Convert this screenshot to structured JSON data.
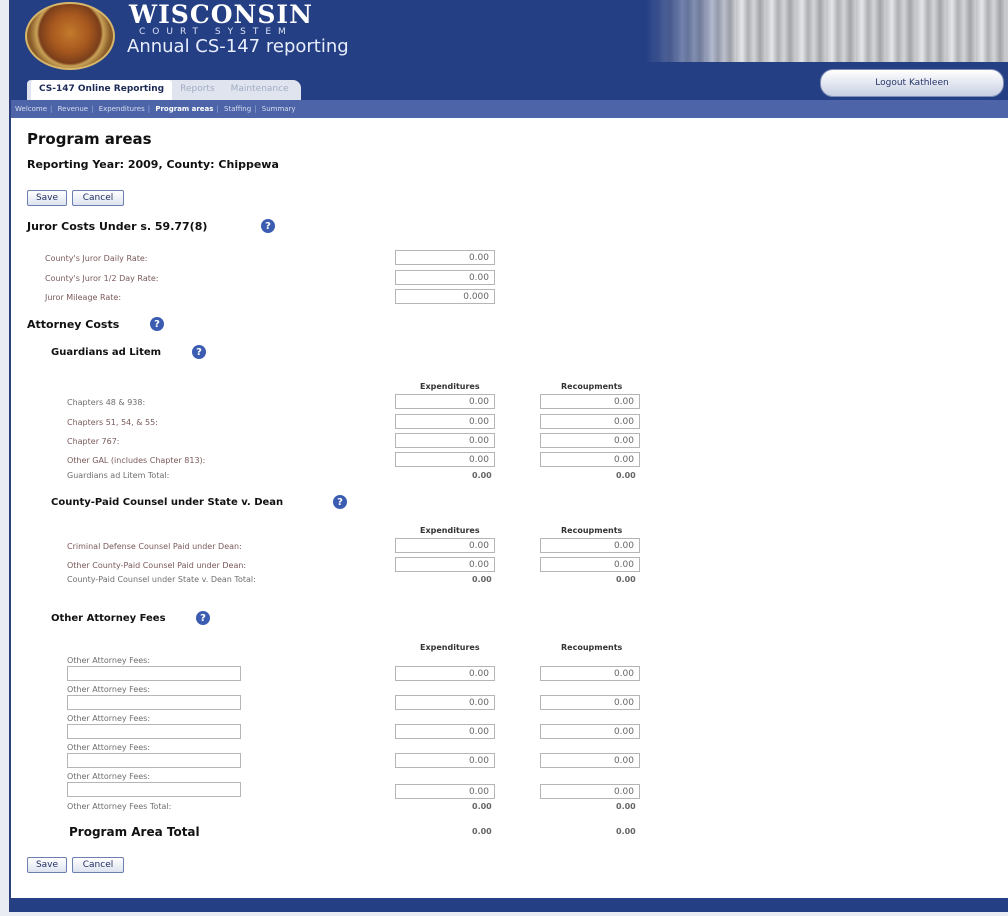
{
  "header": {
    "title_main": "WISCONSIN",
    "title_sub": "COURT SYSTEM",
    "title_app": "Annual CS-147 reporting",
    "logout_label": "Logout Kathleen"
  },
  "tabs": [
    {
      "label": "CS-147 Online Reporting",
      "active": true
    },
    {
      "label": "Reports",
      "active": false
    },
    {
      "label": "Maintenance",
      "active": false
    }
  ],
  "subnav": [
    "Welcome",
    "Revenue",
    "Expenditures",
    "Program areas",
    "Staffing",
    "Summary"
  ],
  "page": {
    "title": "Program areas",
    "reporting_line": "Reporting Year: 2009, County: Chippewa",
    "save_label": "Save",
    "cancel_label": "Cancel"
  },
  "juror": {
    "title": "Juror Costs Under s. 59.77(8)",
    "rows": [
      {
        "label": "County's Juror Daily Rate:",
        "value": "0.00"
      },
      {
        "label": "County's Juror 1/2 Day Rate:",
        "value": "0.00"
      },
      {
        "label": "Juror Mileage Rate:",
        "value": "0.000"
      }
    ]
  },
  "attorney": {
    "title": "Attorney Costs",
    "col_exp": "Expenditures",
    "col_rec": "Recoupments",
    "gal": {
      "title": "Guardians ad Litem",
      "rows": [
        {
          "label": "Chapters 48 & 938:",
          "exp": "0.00",
          "rec": "0.00"
        },
        {
          "label": "Chapters 51, 54, & 55:",
          "exp": "0.00",
          "rec": "0.00"
        },
        {
          "label": "Chapter 767:",
          "exp": "0.00",
          "rec": "0.00"
        },
        {
          "label": "Other GAL (includes Chapter 813):",
          "exp": "0.00",
          "rec": "0.00"
        }
      ],
      "total_label": "Guardians ad Litem Total:",
      "total_exp": "0.00",
      "total_rec": "0.00"
    },
    "dean": {
      "title": "County-Paid Counsel under State v. Dean",
      "rows": [
        {
          "label": "Criminal Defense Counsel Paid under Dean:",
          "exp": "0.00",
          "rec": "0.00"
        },
        {
          "label": "Other County-Paid Counsel Paid under Dean:",
          "exp": "0.00",
          "rec": "0.00"
        }
      ],
      "total_label": "County-Paid Counsel under State v. Dean Total:",
      "total_exp": "0.00",
      "total_rec": "0.00"
    },
    "other": {
      "title": "Other Attorney Fees",
      "row_label": "Other Attorney Fees:",
      "rows": [
        {
          "exp": "0.00",
          "rec": "0.00"
        },
        {
          "exp": "0.00",
          "rec": "0.00"
        },
        {
          "exp": "0.00",
          "rec": "0.00"
        },
        {
          "exp": "0.00",
          "rec": "0.00"
        },
        {
          "exp": "0.00",
          "rec": "0.00"
        }
      ],
      "total_label": "Other Attorney Fees Total:",
      "total_exp": "0.00",
      "total_rec": "0.00"
    }
  },
  "program_total": {
    "label": "Program Area Total",
    "exp": "0.00",
    "rec": "0.00"
  },
  "help_glyph": "?"
}
